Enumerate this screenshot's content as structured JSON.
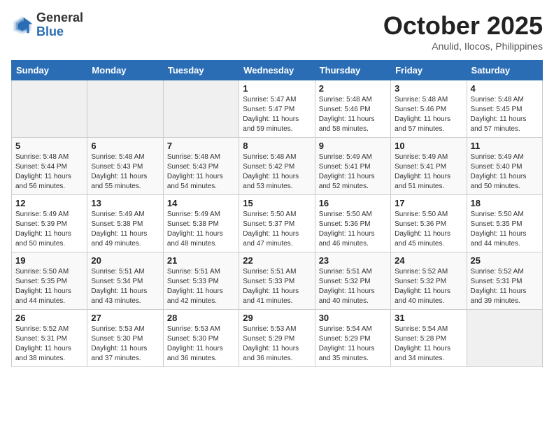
{
  "header": {
    "logo_general": "General",
    "logo_blue": "Blue",
    "month": "October 2025",
    "location": "Anulid, Ilocos, Philippines"
  },
  "days_of_week": [
    "Sunday",
    "Monday",
    "Tuesday",
    "Wednesday",
    "Thursday",
    "Friday",
    "Saturday"
  ],
  "weeks": [
    [
      {
        "day": "",
        "info": ""
      },
      {
        "day": "",
        "info": ""
      },
      {
        "day": "",
        "info": ""
      },
      {
        "day": "1",
        "info": "Sunrise: 5:47 AM\nSunset: 5:47 PM\nDaylight: 11 hours\nand 59 minutes."
      },
      {
        "day": "2",
        "info": "Sunrise: 5:48 AM\nSunset: 5:46 PM\nDaylight: 11 hours\nand 58 minutes."
      },
      {
        "day": "3",
        "info": "Sunrise: 5:48 AM\nSunset: 5:46 PM\nDaylight: 11 hours\nand 57 minutes."
      },
      {
        "day": "4",
        "info": "Sunrise: 5:48 AM\nSunset: 5:45 PM\nDaylight: 11 hours\nand 57 minutes."
      }
    ],
    [
      {
        "day": "5",
        "info": "Sunrise: 5:48 AM\nSunset: 5:44 PM\nDaylight: 11 hours\nand 56 minutes."
      },
      {
        "day": "6",
        "info": "Sunrise: 5:48 AM\nSunset: 5:43 PM\nDaylight: 11 hours\nand 55 minutes."
      },
      {
        "day": "7",
        "info": "Sunrise: 5:48 AM\nSunset: 5:43 PM\nDaylight: 11 hours\nand 54 minutes."
      },
      {
        "day": "8",
        "info": "Sunrise: 5:48 AM\nSunset: 5:42 PM\nDaylight: 11 hours\nand 53 minutes."
      },
      {
        "day": "9",
        "info": "Sunrise: 5:49 AM\nSunset: 5:41 PM\nDaylight: 11 hours\nand 52 minutes."
      },
      {
        "day": "10",
        "info": "Sunrise: 5:49 AM\nSunset: 5:41 PM\nDaylight: 11 hours\nand 51 minutes."
      },
      {
        "day": "11",
        "info": "Sunrise: 5:49 AM\nSunset: 5:40 PM\nDaylight: 11 hours\nand 50 minutes."
      }
    ],
    [
      {
        "day": "12",
        "info": "Sunrise: 5:49 AM\nSunset: 5:39 PM\nDaylight: 11 hours\nand 50 minutes."
      },
      {
        "day": "13",
        "info": "Sunrise: 5:49 AM\nSunset: 5:38 PM\nDaylight: 11 hours\nand 49 minutes."
      },
      {
        "day": "14",
        "info": "Sunrise: 5:49 AM\nSunset: 5:38 PM\nDaylight: 11 hours\nand 48 minutes."
      },
      {
        "day": "15",
        "info": "Sunrise: 5:50 AM\nSunset: 5:37 PM\nDaylight: 11 hours\nand 47 minutes."
      },
      {
        "day": "16",
        "info": "Sunrise: 5:50 AM\nSunset: 5:36 PM\nDaylight: 11 hours\nand 46 minutes."
      },
      {
        "day": "17",
        "info": "Sunrise: 5:50 AM\nSunset: 5:36 PM\nDaylight: 11 hours\nand 45 minutes."
      },
      {
        "day": "18",
        "info": "Sunrise: 5:50 AM\nSunset: 5:35 PM\nDaylight: 11 hours\nand 44 minutes."
      }
    ],
    [
      {
        "day": "19",
        "info": "Sunrise: 5:50 AM\nSunset: 5:35 PM\nDaylight: 11 hours\nand 44 minutes."
      },
      {
        "day": "20",
        "info": "Sunrise: 5:51 AM\nSunset: 5:34 PM\nDaylight: 11 hours\nand 43 minutes."
      },
      {
        "day": "21",
        "info": "Sunrise: 5:51 AM\nSunset: 5:33 PM\nDaylight: 11 hours\nand 42 minutes."
      },
      {
        "day": "22",
        "info": "Sunrise: 5:51 AM\nSunset: 5:33 PM\nDaylight: 11 hours\nand 41 minutes."
      },
      {
        "day": "23",
        "info": "Sunrise: 5:51 AM\nSunset: 5:32 PM\nDaylight: 11 hours\nand 40 minutes."
      },
      {
        "day": "24",
        "info": "Sunrise: 5:52 AM\nSunset: 5:32 PM\nDaylight: 11 hours\nand 40 minutes."
      },
      {
        "day": "25",
        "info": "Sunrise: 5:52 AM\nSunset: 5:31 PM\nDaylight: 11 hours\nand 39 minutes."
      }
    ],
    [
      {
        "day": "26",
        "info": "Sunrise: 5:52 AM\nSunset: 5:31 PM\nDaylight: 11 hours\nand 38 minutes."
      },
      {
        "day": "27",
        "info": "Sunrise: 5:53 AM\nSunset: 5:30 PM\nDaylight: 11 hours\nand 37 minutes."
      },
      {
        "day": "28",
        "info": "Sunrise: 5:53 AM\nSunset: 5:30 PM\nDaylight: 11 hours\nand 36 minutes."
      },
      {
        "day": "29",
        "info": "Sunrise: 5:53 AM\nSunset: 5:29 PM\nDaylight: 11 hours\nand 36 minutes."
      },
      {
        "day": "30",
        "info": "Sunrise: 5:54 AM\nSunset: 5:29 PM\nDaylight: 11 hours\nand 35 minutes."
      },
      {
        "day": "31",
        "info": "Sunrise: 5:54 AM\nSunset: 5:28 PM\nDaylight: 11 hours\nand 34 minutes."
      },
      {
        "day": "",
        "info": ""
      }
    ]
  ]
}
